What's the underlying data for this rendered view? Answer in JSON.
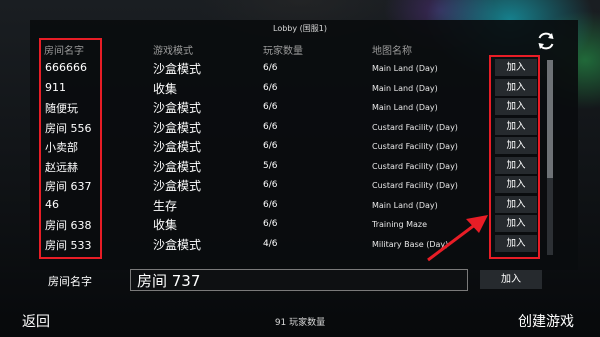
{
  "header": {
    "title": "Lobby (国服1)"
  },
  "columns": {
    "room_name": "房间名字",
    "game_mode": "游戏模式",
    "player_count": "玩家数量",
    "map_name": "地图名称"
  },
  "rooms": [
    {
      "name": "666666",
      "mode": "沙盒模式",
      "players": "6/6",
      "map": "Main Land (Day)",
      "join": "加入"
    },
    {
      "name": "911",
      "mode": "收集",
      "players": "6/6",
      "map": "Main Land (Day)",
      "join": "加入"
    },
    {
      "name": "随便玩",
      "mode": "沙盒模式",
      "players": "6/6",
      "map": "Main Land (Day)",
      "join": "加入"
    },
    {
      "name": "房间 556",
      "mode": "沙盒模式",
      "players": "6/6",
      "map": "Custard Facility (Day)",
      "join": "加入"
    },
    {
      "name": "小卖部",
      "mode": "沙盒模式",
      "players": "6/6",
      "map": "Custard Facility (Day)",
      "join": "加入"
    },
    {
      "name": "赵远赫",
      "mode": "沙盒模式",
      "players": "5/6",
      "map": "Custard Facility (Day)",
      "join": "加入"
    },
    {
      "name": "房间 637",
      "mode": "沙盒模式",
      "players": "6/6",
      "map": "Custard Facility (Day)",
      "join": "加入"
    },
    {
      "name": "46",
      "mode": "生存",
      "players": "6/6",
      "map": "Main Land (Day)",
      "join": "加入"
    },
    {
      "name": "房间 638",
      "mode": "收集",
      "players": "6/6",
      "map": "Training Maze",
      "join": "加入"
    },
    {
      "name": "房间 533",
      "mode": "沙盒模式",
      "players": "4/6",
      "map": "Military Base (Day)",
      "join": "加入"
    }
  ],
  "footer": {
    "room_name_label": "房间名字",
    "room_name_value": "房间 737",
    "join_label": "加入",
    "back_label": "返回",
    "player_count_text": "91 玩家数量",
    "create_label": "创建游戏"
  },
  "colors": {
    "highlight": "#e81d26",
    "button_bg": "#262a2e"
  }
}
